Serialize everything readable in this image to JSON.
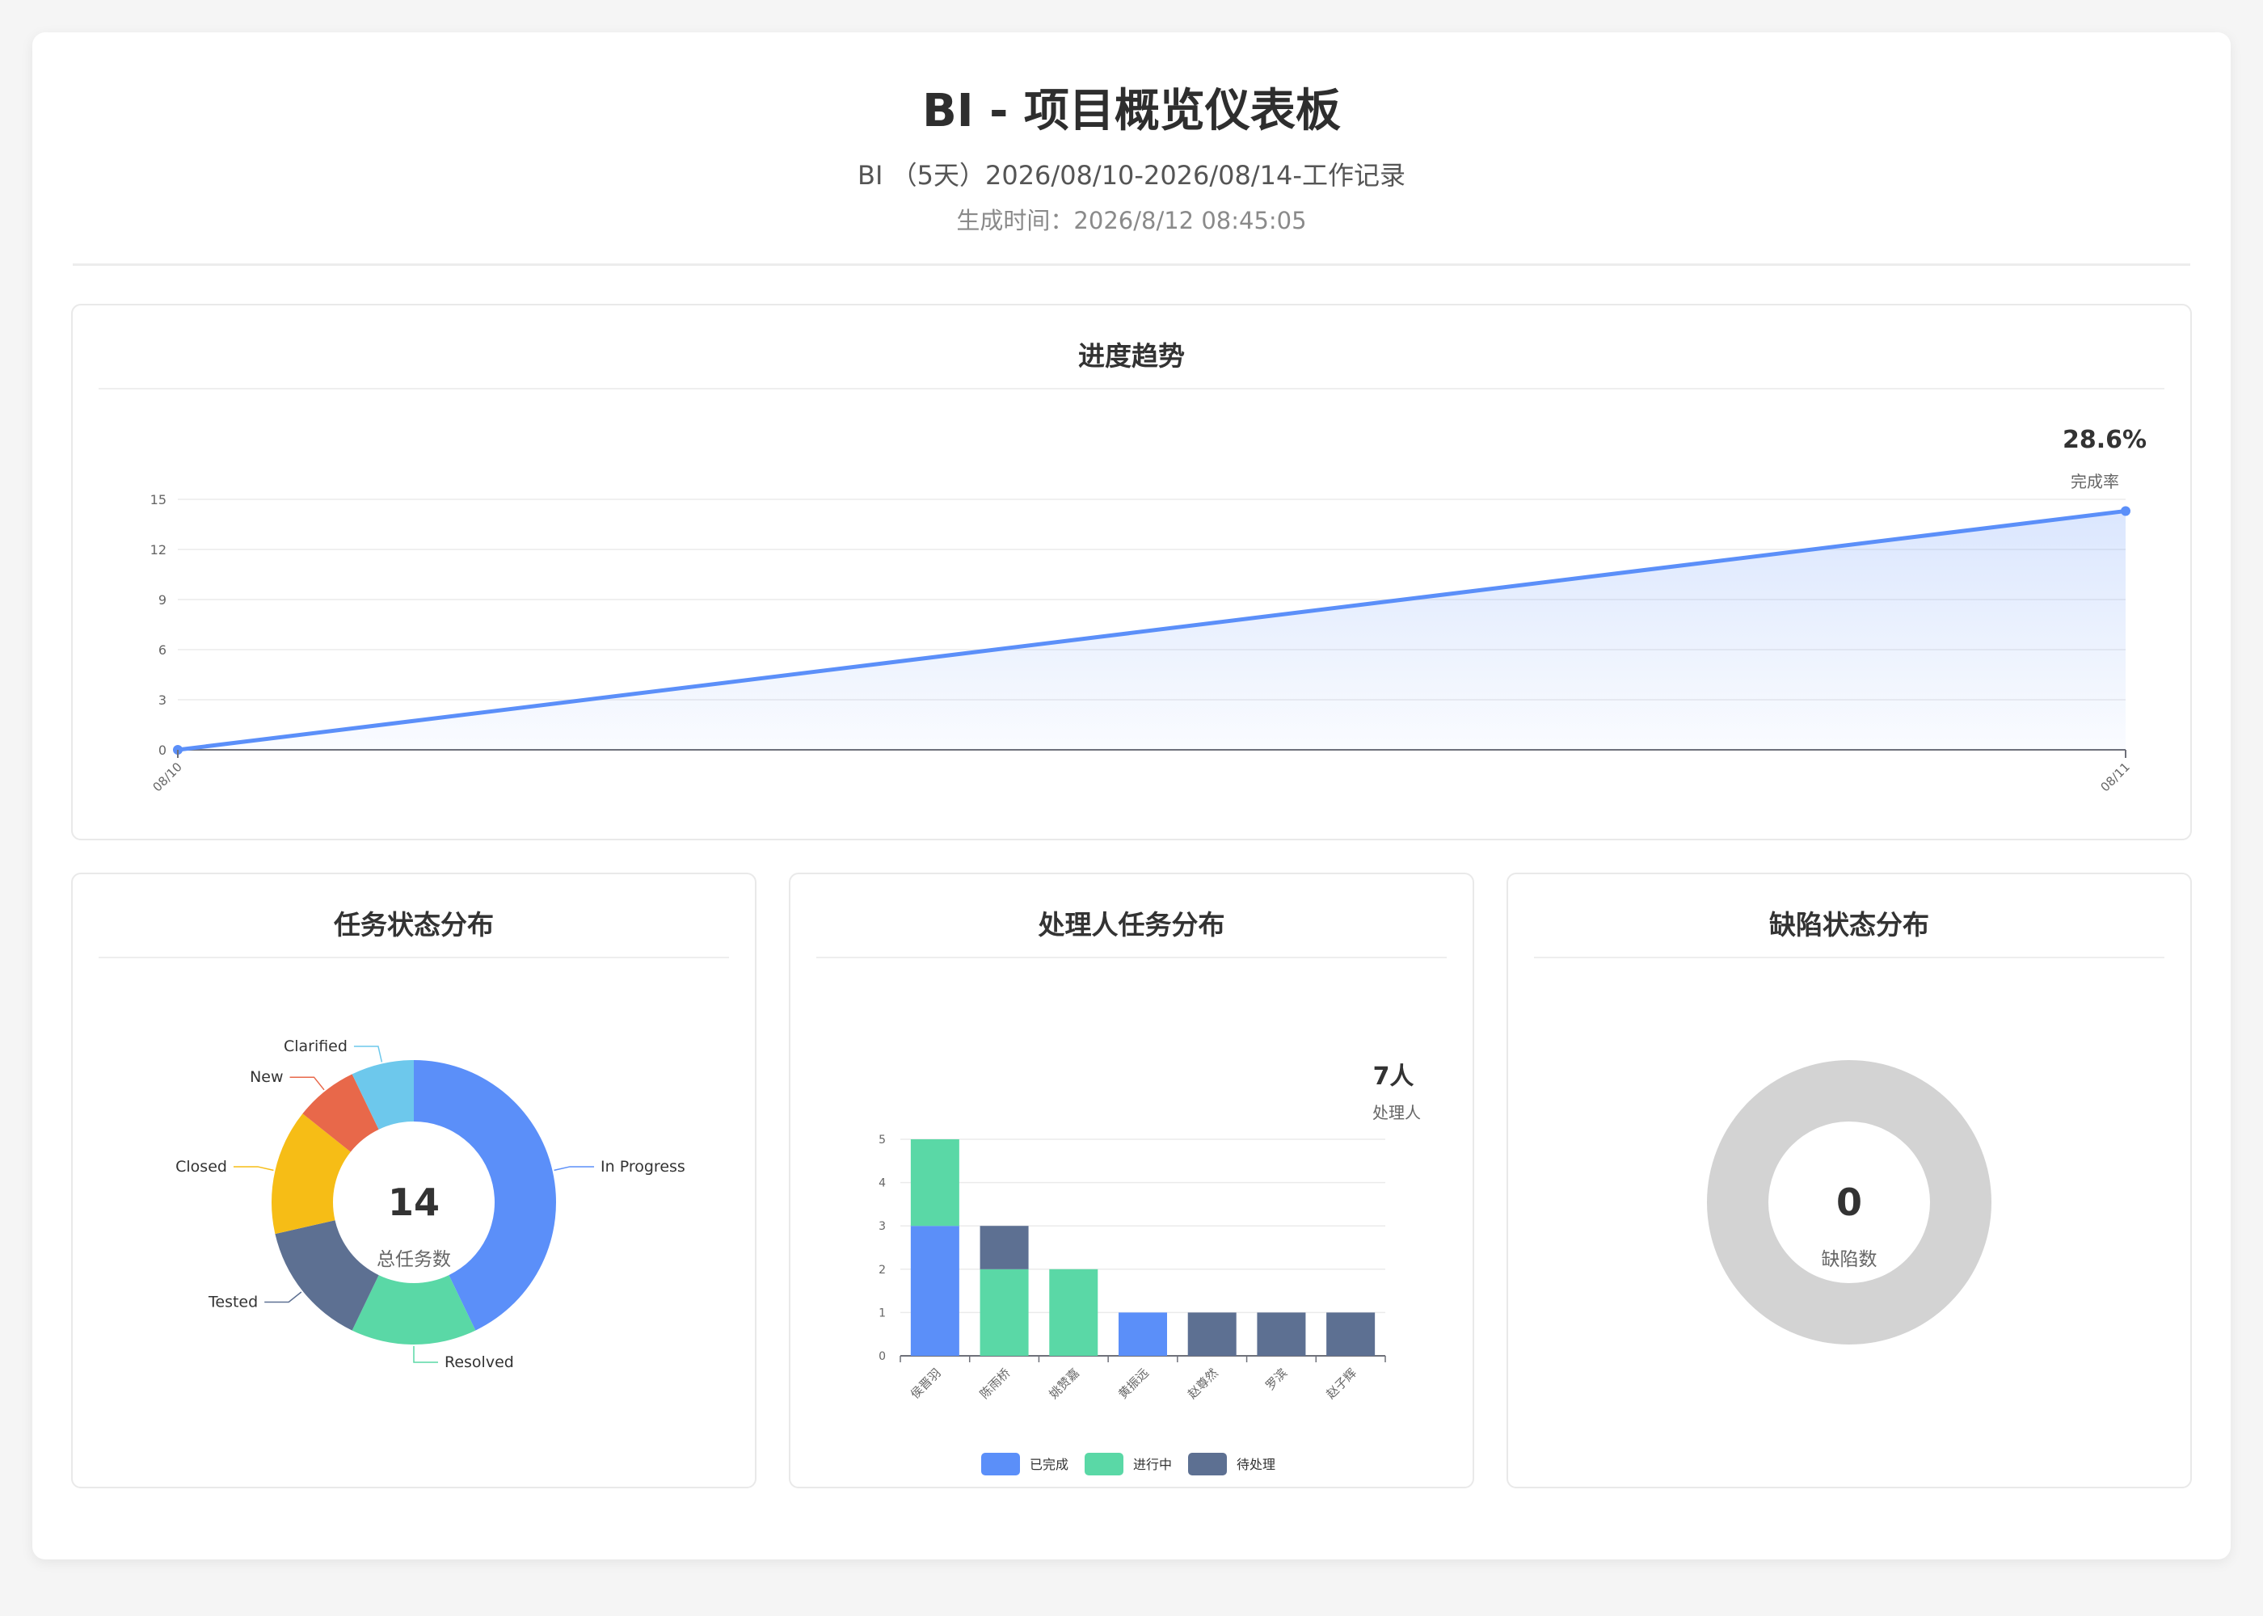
{
  "header": {
    "title": "BI - 项目概览仪表板",
    "subtitle": "BI （5天）2026/08/10-2026/08/14-工作记录",
    "gentime_label": "生成时间：",
    "gentime_value": "2026/8/12 08:45:05"
  },
  "progress_panel": {
    "title": "进度趋势",
    "kpi_value": "28.6%",
    "kpi_label": "完成率"
  },
  "status_panel": {
    "title": "任务状态分布",
    "center_value": "14",
    "center_label": "总任务数"
  },
  "assignee_panel": {
    "title": "处理人任务分布",
    "kpi_value": "7人",
    "kpi_label": "处理人"
  },
  "defect_panel": {
    "title": "缺陷状态分布",
    "center_value": "0",
    "center_label": "缺陷数"
  },
  "colors": {
    "blue": "#5b8ff9",
    "green": "#5ad8a6",
    "slate": "#5d7092",
    "yellow": "#f6bd16",
    "red": "#e8684a",
    "cyan": "#6dc8ec",
    "grey": "#d3d3d3"
  },
  "chart_data": [
    {
      "type": "area",
      "x": [
        "08/10",
        "08/11"
      ],
      "y": [
        0,
        14.3
      ],
      "yticks": [
        0,
        3,
        6,
        9,
        12,
        15
      ],
      "ylim": [
        0,
        15
      ],
      "grid": true
    },
    {
      "type": "pie",
      "labels": [
        "In Progress",
        "Resolved",
        "Tested",
        "Closed",
        "New",
        "Clarified"
      ],
      "values": [
        6,
        2,
        2,
        2,
        1,
        1
      ],
      "colors": [
        "#5b8ff9",
        "#5ad8a6",
        "#5d7092",
        "#f6bd16",
        "#e8684a",
        "#6dc8ec"
      ]
    },
    {
      "type": "bar",
      "stacked": true,
      "categories": [
        "侯晋羽",
        "陈雨桥",
        "姚赞嘉",
        "黄振远",
        "赵尊然",
        "罗滨",
        "赵子辉"
      ],
      "series": [
        {
          "name": "已完成",
          "values": [
            3,
            0,
            0,
            1,
            0,
            0,
            0
          ],
          "color": "#5b8ff9"
        },
        {
          "name": "进行中",
          "values": [
            2,
            2,
            2,
            0,
            0,
            0,
            0
          ],
          "color": "#5ad8a6"
        },
        {
          "name": "待处理",
          "values": [
            0,
            1,
            0,
            0,
            1,
            1,
            1
          ],
          "color": "#5d7092"
        }
      ],
      "yticks": [
        0,
        1,
        2,
        3,
        4,
        5
      ],
      "ylim": [
        0,
        5
      ],
      "legend": "bottom"
    },
    {
      "type": "pie",
      "labels": [],
      "values": [],
      "total": 0
    }
  ]
}
